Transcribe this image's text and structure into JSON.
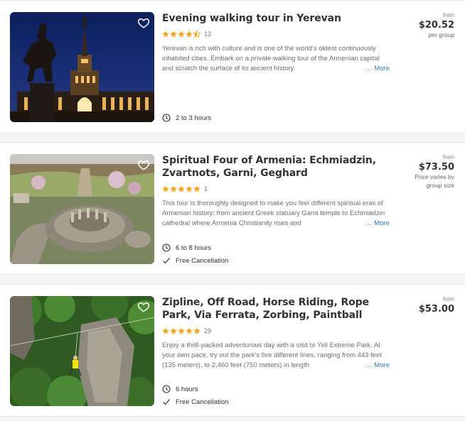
{
  "colors": {
    "star": "#f5a623",
    "link": "#2f7fc9",
    "title": "#333333"
  },
  "tours": [
    {
      "title": "Evening walking tour in Yerevan",
      "rating_count": "13",
      "stars": 4.5,
      "description": "Yerevan is rich with culture and is one of the world's oldest continuously inhabited cities. Embark on a private walking tour of the Armenian capital and scratch the surface of its ancient history",
      "more": "More",
      "duration": "2 to 3 hours",
      "cancellation": "",
      "price_from": "from",
      "price": "$20.52",
      "price_note": "per group"
    },
    {
      "title": "Spiritual Four of Armenia: Echmiadzin, Zvartnots, Garni, Geghard",
      "rating_count": "1",
      "stars": 5,
      "description": "This tour is thoroughly designed to make you feel different spiritual eras of Armenian history: from ancient Greek statuary Garni temple to Echmiadzin cathedral where Armenia Christianity rises and",
      "more": "More",
      "duration": "6 to 8 hours",
      "cancellation": "Free Cancellation",
      "price_from": "from",
      "price": "$73.50",
      "price_note": "Price varies by group size"
    },
    {
      "title": "Zipline, Off Road, Horse Riding, Rope Park, Via Ferrata, Zorbing, Paintball",
      "rating_count": "29",
      "stars": 5,
      "description": "Enjoy a thrill-packed adventurous day with a visit to Yell Extreme Park. At your own pace, try out the park's five different lines, ranging from 443 feet (135 meters), to 2,460 feet (750 meters) in length",
      "more": "More",
      "duration": "6 hours",
      "cancellation": "Free Cancellation",
      "price_from": "from",
      "price": "$53.00",
      "price_note": ""
    }
  ]
}
